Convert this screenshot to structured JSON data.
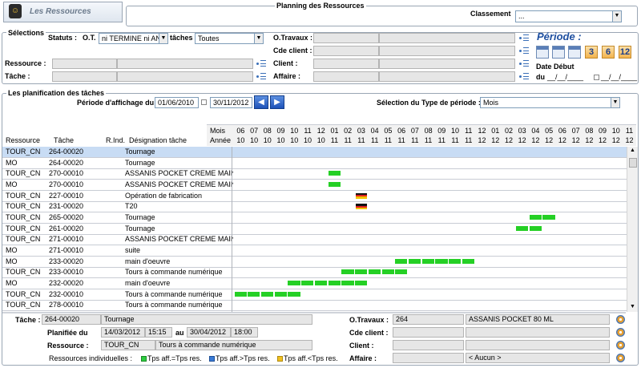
{
  "header": {
    "app_title": "Les Ressources",
    "planning_title": "Planning des Ressources",
    "classement_label": "Classement",
    "classement_value": "..."
  },
  "selections": {
    "title": "Sélections",
    "statuts_label": "Statuts :",
    "ot_label": "O.T.",
    "ot_value": "ni TERMINE ni AN",
    "taches_label": "tâches",
    "taches_value": "Toutes",
    "ressource_label": "Ressource :",
    "tache_label": "Tâche :",
    "otravaux_label": "O.Travaux :",
    "cde_label": "Cde client :",
    "client_label": "Client :",
    "affaire_label": "Affaire :",
    "periode_label": "Période :",
    "period_buttons": [
      "3",
      "6",
      "12"
    ],
    "date_debut_label": "Date Début",
    "du_label": "du",
    "du_value": "__/__/____",
    "au_value": "__/__/____"
  },
  "planif": {
    "title": "Les planification des tâches",
    "periode_label": "Période d'affichage du",
    "date_from": "01/06/2010",
    "date_to": "30/11/2012",
    "type_label": "Sélection du Type de période :",
    "type_value": "Mois"
  },
  "grid": {
    "col_ressource": "Ressource",
    "col_tache": "Tâche",
    "col_rind": "R.Ind.",
    "col_designation": "Désignation tâche",
    "mois_label": "Mois",
    "annee_label": "Année",
    "months": [
      "06",
      "07",
      "08",
      "09",
      "10",
      "11",
      "12",
      "01",
      "02",
      "03",
      "04",
      "05",
      "06",
      "07",
      "08",
      "09",
      "10",
      "11",
      "12",
      "01",
      "02",
      "03",
      "04",
      "05",
      "06",
      "07",
      "08",
      "09",
      "10",
      "11"
    ],
    "years": [
      "10",
      "10",
      "10",
      "10",
      "10",
      "10",
      "10",
      "11",
      "11",
      "11",
      "11",
      "11",
      "11",
      "11",
      "11",
      "11",
      "11",
      "11",
      "12",
      "12",
      "12",
      "12",
      "12",
      "12",
      "12",
      "12",
      "12",
      "12",
      "12",
      "12"
    ],
    "rows": [
      {
        "ressource": "TOUR_CN",
        "tache": "264-00020",
        "designation": "Tournage",
        "bars": [],
        "flags": []
      },
      {
        "ressource": "MO",
        "tache": "264-00020",
        "designation": "Tournage",
        "bars": [],
        "flags": []
      },
      {
        "ressource": "TOUR_CN",
        "tache": "270-00010",
        "designation": "ASSANIS POCKET CREME MAIN",
        "bars": [
          7
        ],
        "flags": []
      },
      {
        "ressource": "MO",
        "tache": "270-00010",
        "designation": "ASSANIS POCKET CREME MAIN",
        "bars": [
          7
        ],
        "flags": []
      },
      {
        "ressource": "TOUR_CN",
        "tache": "227-00010",
        "designation": "Opération de fabrication",
        "bars": [],
        "flags": [
          9
        ]
      },
      {
        "ressource": "TOUR_CN",
        "tache": "231-00020",
        "designation": "T20",
        "bars": [],
        "flags": [
          9
        ]
      },
      {
        "ressource": "TOUR_CN",
        "tache": "265-00020",
        "designation": "Tournage",
        "bars": [
          22,
          23
        ],
        "flags": []
      },
      {
        "ressource": "TOUR_CN",
        "tache": "261-00020",
        "designation": "Tournage",
        "bars": [
          21,
          22
        ],
        "flags": []
      },
      {
        "ressource": "TOUR_CN",
        "tache": "271-00010",
        "designation": "ASSANIS POCKET CREME MAIN",
        "bars": [],
        "flags": []
      },
      {
        "ressource": "MO",
        "tache": "271-00010",
        "designation": "suite",
        "bars": [],
        "flags": []
      },
      {
        "ressource": "MO",
        "tache": "233-00020",
        "designation": "main d'oeuvre",
        "bars": [
          12,
          13,
          14,
          15,
          16,
          17
        ],
        "flags": []
      },
      {
        "ressource": "TOUR_CN",
        "tache": "233-00010",
        "designation": "Tours à commande numérique",
        "bars": [
          8,
          9,
          10,
          11,
          12
        ],
        "flags": []
      },
      {
        "ressource": "MO",
        "tache": "232-00020",
        "designation": "main d'oeuvre",
        "bars": [
          4,
          5,
          6,
          7,
          8,
          9
        ],
        "flags": []
      },
      {
        "ressource": "TOUR_CN",
        "tache": "232-00010",
        "designation": "Tours à commande numérique",
        "bars": [
          0,
          1,
          2,
          3,
          4
        ],
        "flags": []
      },
      {
        "ressource": "TOUR_CN",
        "tache": "278-00010",
        "designation": "Tours à commande numérique",
        "bars": [],
        "flags": []
      }
    ]
  },
  "details": {
    "tache_label": "Tâche :",
    "tache_code": "264-00020",
    "tache_desc": "Tournage",
    "planifie_label": "Planifiée du",
    "pdate": "14/03/2012",
    "ptime": "15:15",
    "au_label": "au",
    "adate": "30/04/2012",
    "atime": "18:00",
    "ressource_label": "Ressource :",
    "ressource_code": "TOUR_CN",
    "ressource_desc": "Tours à commande numérique",
    "otravaux_label": "O.Travaux :",
    "otravaux_num": "264",
    "otravaux_desc": "ASSANIS POCKET 80 ML",
    "cde_label": "Cde client :",
    "client_label": "Client :",
    "affaire_label": "Affaire :",
    "affaire_value": "< Aucun >"
  },
  "legend": {
    "title": "Ressources individuelles :",
    "items": [
      {
        "label": "Tps aff.=Tps res.",
        "color": "#2ecc40"
      },
      {
        "label": "Tps aff.>Tps res.",
        "color": "#3a7bd5"
      },
      {
        "label": "Tps aff.<Tps res.",
        "color": "#f0c020"
      }
    ]
  },
  "colors": {
    "bar": "#25d025",
    "selected_row": "#c8dcf4",
    "accent": "#1e4fa0"
  }
}
